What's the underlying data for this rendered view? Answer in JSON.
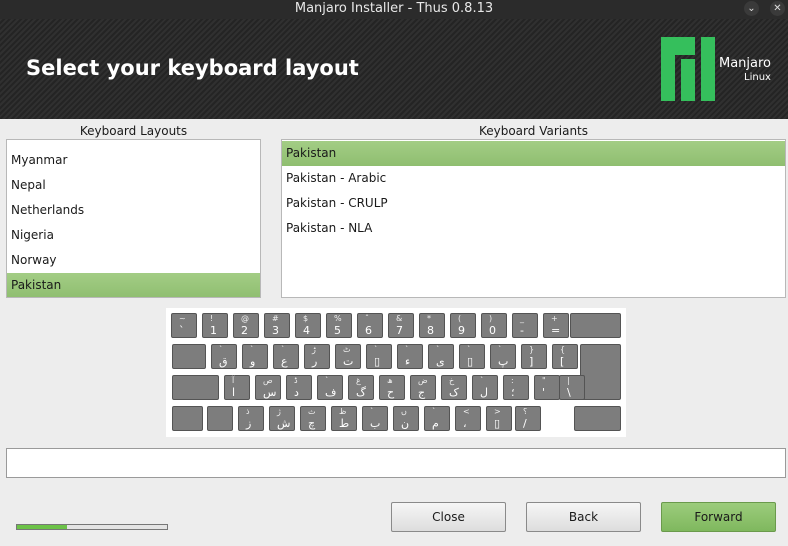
{
  "window": {
    "title": "Manjaro Installer - Thus 0.8.13",
    "minimize_glyph": "⌄",
    "close_glyph": "✕"
  },
  "header": {
    "title": "Select your keyboard layout",
    "logo_text": "Manjaro",
    "logo_sub": "Linux",
    "logo_color": "#35bf5c"
  },
  "layouts": {
    "title": "Keyboard Layouts",
    "items": [
      "Myanmar",
      "Nepal",
      "Netherlands",
      "Nigeria",
      "Norway",
      "Pakistan"
    ],
    "selected": "Pakistan"
  },
  "variants": {
    "title": "Keyboard Variants",
    "items": [
      "Pakistan",
      "Pakistan - Arabic",
      "Pakistan - CRULP",
      "Pakistan - NLA"
    ],
    "selected": "Pakistan"
  },
  "keyboard": {
    "row1": [
      [
        "~",
        "ˋ"
      ],
      [
        "!",
        "1"
      ],
      [
        "@",
        "2"
      ],
      [
        "#",
        "3"
      ],
      [
        "$",
        "4"
      ],
      [
        "%",
        "5"
      ],
      [
        "ˆ",
        "6"
      ],
      [
        "&",
        "7"
      ],
      [
        "*",
        "8"
      ],
      [
        "(",
        "9"
      ],
      [
        ")",
        "0"
      ],
      [
        "_",
        "-"
      ],
      [
        "+",
        "="
      ]
    ],
    "row2": [
      [
        "ˋ",
        "ق"
      ],
      [
        "ˋ",
        "و"
      ],
      [
        "ˋ",
        "ع"
      ],
      [
        "ڑ",
        "ر"
      ],
      [
        "ٹ",
        "ت"
      ],
      [
        "ˋ",
        "▯"
      ],
      [
        "ˋ",
        "ء"
      ],
      [
        "ˋ",
        "ی"
      ],
      [
        "ˋ",
        "▯"
      ],
      [
        "ˋ",
        "پ"
      ],
      [
        "}",
        "]"
      ],
      [
        "{",
        "["
      ]
    ],
    "row3": [
      [
        "آ",
        "ا"
      ],
      [
        "ص",
        "س"
      ],
      [
        "ڈ",
        "د"
      ],
      [
        "ˋ",
        "ف"
      ],
      [
        "غ",
        "گ"
      ],
      [
        "ھ",
        "ح"
      ],
      [
        "ض",
        "ج"
      ],
      [
        "خ",
        "ک"
      ],
      [
        "ˋ",
        "ل"
      ],
      [
        ":",
        "؛"
      ],
      [
        "\"",
        "'"
      ],
      [
        "|",
        "\\"
      ]
    ],
    "row4": [
      [
        "ذ",
        "ز"
      ],
      [
        "ژ",
        "ش"
      ],
      [
        "ث",
        "چ"
      ],
      [
        "ظ",
        "ط"
      ],
      [
        "ˋ",
        "ب"
      ],
      [
        "ں",
        "ن"
      ],
      [
        "ˋ",
        "م"
      ],
      [
        "<",
        "،"
      ],
      [
        ">",
        "▯"
      ],
      [
        "؟",
        "/"
      ]
    ]
  },
  "test_field": {
    "value": "",
    "placeholder": ""
  },
  "progress": {
    "fraction": 0.33,
    "color": "#6cc248"
  },
  "buttons": {
    "close": "Close",
    "back": "Back",
    "forward": "Forward"
  }
}
